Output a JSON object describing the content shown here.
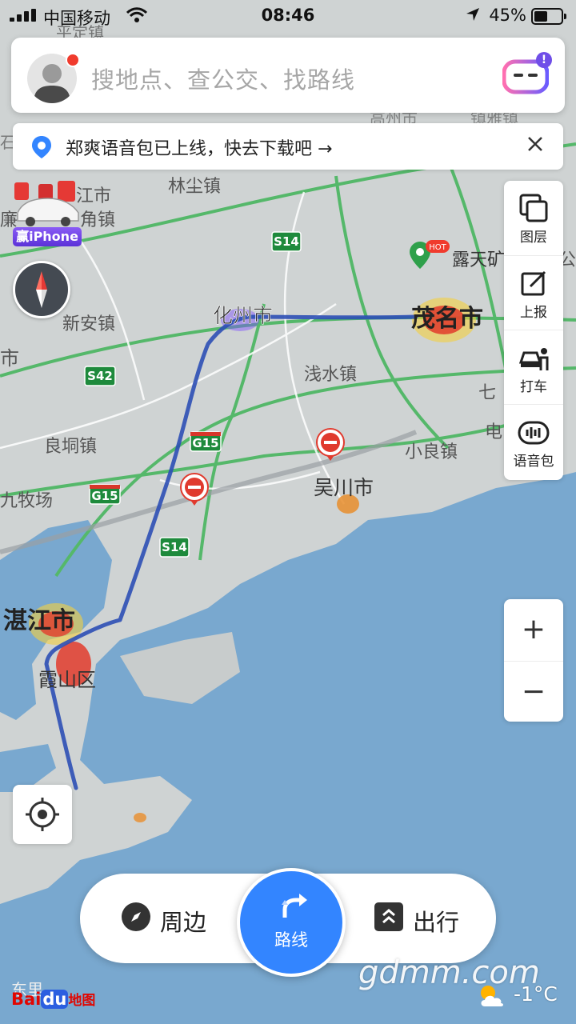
{
  "status_bar": {
    "carrier": "中国移动",
    "time": "08:46",
    "battery": "45%"
  },
  "search": {
    "placeholder": "搜地点、查公交、找路线",
    "assistant_badge": "!"
  },
  "notice": {
    "text": "郑爽语音包已上线，快去下载吧 →"
  },
  "promo": {
    "label": "赢iPhone"
  },
  "tools": [
    {
      "label": "图层",
      "icon": "layers-icon"
    },
    {
      "label": "上报",
      "icon": "report-icon"
    },
    {
      "label": "打车",
      "icon": "taxi-icon"
    },
    {
      "label": "语音包",
      "icon": "voice-pack-icon"
    }
  ],
  "zoom": {
    "in": "+",
    "out": "−"
  },
  "bottom_nav": {
    "nearby": "周边",
    "route": "路线",
    "trip": "出行"
  },
  "map_labels": {
    "top_town_partial": "平定镇",
    "lianjiang": "江市",
    "lianjiang_town": "廉",
    "shitou_town": "角镇",
    "left_city_partial": "市",
    "left_town_partial": "石",
    "linchen": "林尘镇",
    "xinan": "新安镇",
    "huazhou": "化州市",
    "maoming": "茂名市",
    "lutian": "露天矿",
    "gongyuan_partial": "公",
    "qianshui": "浅水镇",
    "qi_partial": "七",
    "dian_partial": "电",
    "liangdong": "良垌镇",
    "xiaoliang": "小良镇",
    "jiuzhuang": "九牧场",
    "wuchuan": "吴川市",
    "zhanjiang": "湛江市",
    "xiashan": "霞山区",
    "donghai_partial": "东里",
    "top_mid_partial": "高州市",
    "top_right_partial": "镇雅镇",
    "hot": "HOT"
  },
  "road_shields": [
    "S14",
    "S42",
    "G15",
    "G15",
    "S14"
  ],
  "logo": {
    "bai": "Bai",
    "du": "du",
    "ditu": "地图"
  },
  "watermark": "gdmm.com",
  "weather": {
    "temp": "-1°C",
    "icon": "partly-cloudy-icon"
  },
  "colors": {
    "accent": "#3385ff",
    "sea": "#79a8cf",
    "land": "#cfd3d3",
    "route": "#2c4fb5",
    "road": "#4cb35f"
  }
}
